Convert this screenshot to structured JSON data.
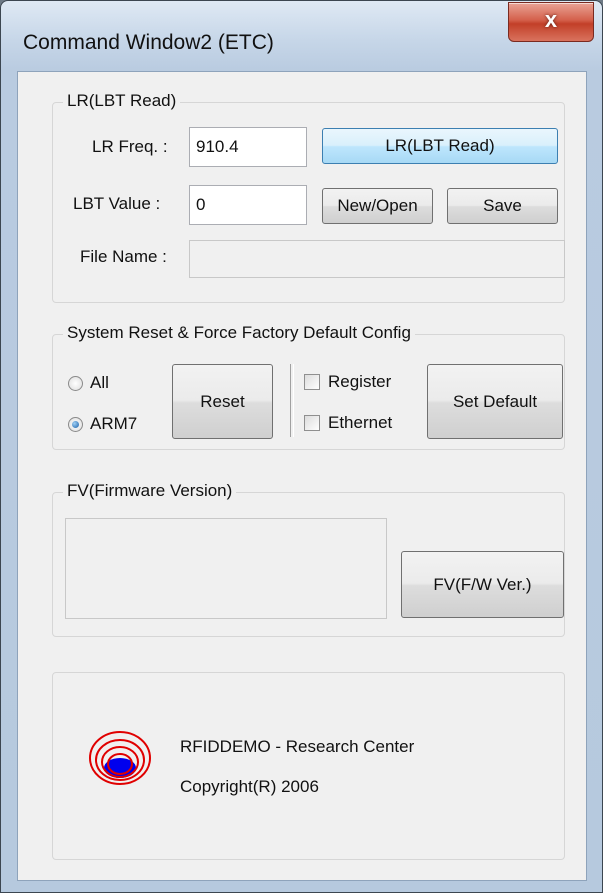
{
  "window": {
    "title": "Command Window2 (ETC)",
    "close_glyph": "x"
  },
  "lr_group": {
    "title": "LR(LBT Read)",
    "freq_label": "LR Freq. :",
    "freq_value": "910.4",
    "lr_button": "LR(LBT Read)",
    "lbt_label": "LBT Value :",
    "lbt_value": "0",
    "new_open_button": "New/Open",
    "save_button": "Save",
    "file_name_label": "File Name :",
    "file_name_value": ""
  },
  "reset_group": {
    "title": "System Reset & Force Factory Default Config",
    "radio_all": "All",
    "radio_arm7": "ARM7",
    "selected_radio": "ARM7",
    "reset_button": "Reset",
    "check_register": "Register",
    "check_ethernet": "Ethernet",
    "set_default_button": "Set Default"
  },
  "fv_group": {
    "title": "FV(Firmware Version)",
    "version_text": "",
    "fv_button": "FV(F/W Ver.)"
  },
  "about": {
    "company": "RFIDDEMO - Research Center",
    "copyright": "Copyright(R) 2006",
    "logo_icon": "rfid-signal-logo-icon"
  },
  "colors": {
    "focus_button": "#bee6fd",
    "logo_red": "#e00000",
    "logo_blue": "#0000ee"
  }
}
